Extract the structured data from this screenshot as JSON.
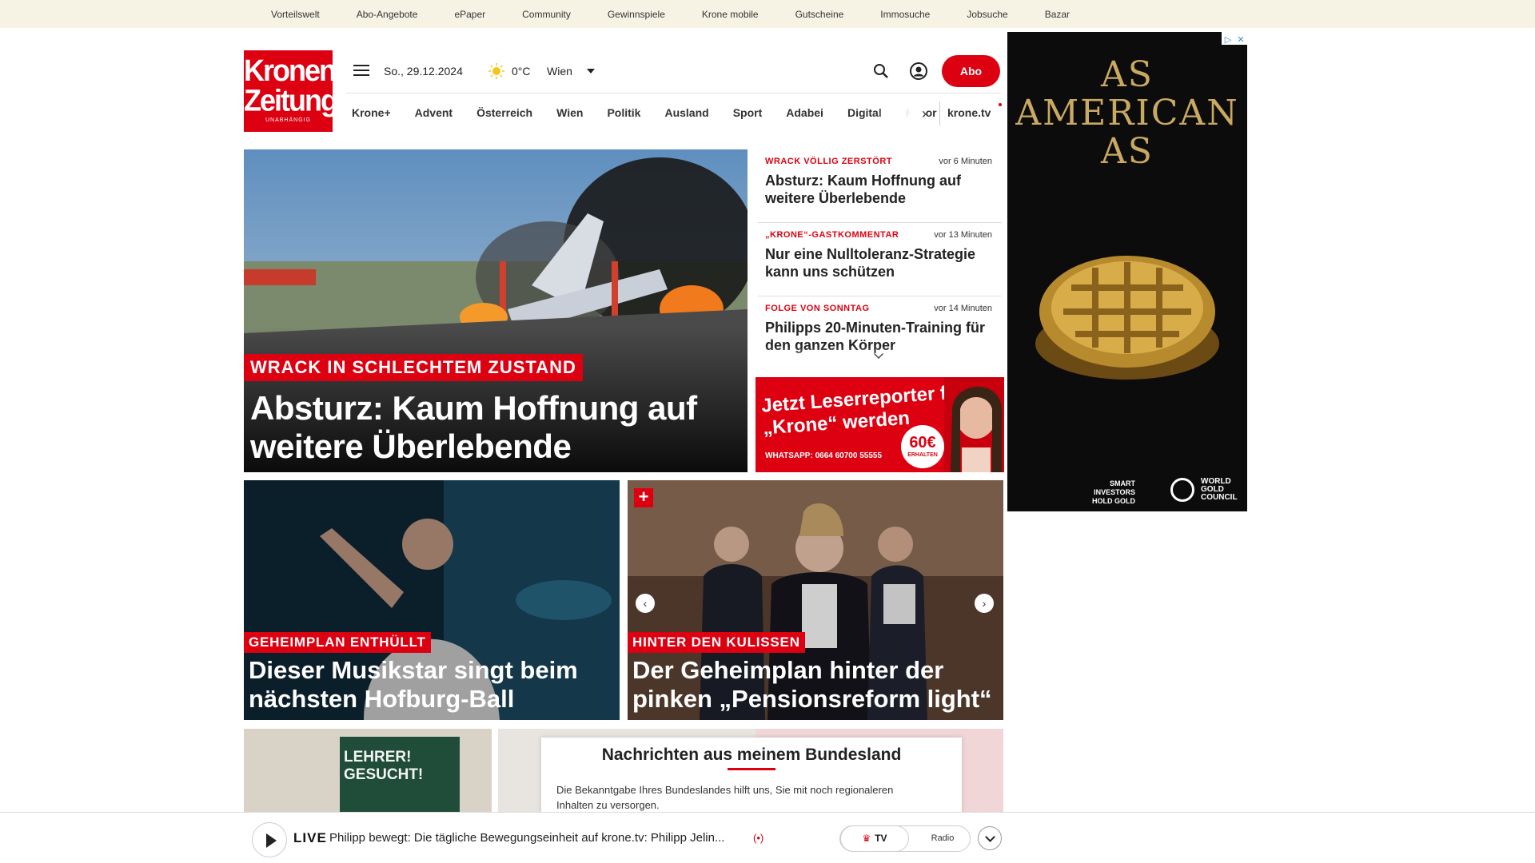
{
  "topbar": {
    "links": [
      "Vorteilswelt",
      "Abo-Angebote",
      "ePaper",
      "Community",
      "Gewinnspiele",
      "Krone mobile",
      "Gutscheine",
      "Immosuche",
      "Jobsuche",
      "Bazar"
    ]
  },
  "logo": {
    "line1": "Kronen",
    "line2": "Zeitung",
    "tagline": "UNABHÄNGIG"
  },
  "header": {
    "date": "So., 29.12.2024",
    "temperature": "0°C",
    "city": "Wien",
    "abo_label": "Abo"
  },
  "nav": {
    "items": [
      "Krone+",
      "Advent",
      "Österreich",
      "Wien",
      "Politik",
      "Ausland",
      "Sport",
      "Adabei",
      "Digital",
      "Motor"
    ],
    "kronetv": "krone.tv"
  },
  "hero": {
    "kicker": "WRACK IN SCHLECHTEM ZUSTAND",
    "title": "Absturz: Kaum Hoffnung auf weitere Überlebende"
  },
  "sidebar_news": [
    {
      "kicker": "WRACK VÖLLIG ZERSTÖRT",
      "time": "vor 6 Minuten",
      "headline": "Absturz: Kaum Hoffnung auf weitere Überlebende"
    },
    {
      "kicker": "„KRONE“-GASTKOMMENTAR",
      "time": "vor 13 Minuten",
      "headline": "Nur eine Nulltoleranz-Strategie kann uns schützen"
    },
    {
      "kicker": "FOLGE VON SONNTAG",
      "time": "vor 14 Minuten",
      "headline": "Philipps 20-Minuten-Training für den ganzen Körper"
    }
  ],
  "reporter_promo": {
    "headline": "Jetzt Leserreporter für die „Krone“ werden",
    "whatsapp": "WHATSAPP: 0664 60700 55555",
    "amount": "60€",
    "amount_note": "ERHALTEN"
  },
  "ad": {
    "headline": "AS AMERICAN AS",
    "slogan": "SMART INVESTORS HOLD GOLD",
    "brand": "WORLD GOLD COUNCIL"
  },
  "cards": [
    {
      "kicker": "GEHEIMPLAN ENTHÜLLT",
      "title": "Dieser Musikstar singt beim nächsten Hofburg-Ball"
    },
    {
      "kicker": "HINTER DEN KULISSEN",
      "title": "Der Geheimplan hinter der pinken „Pensionsreform light“",
      "plus": "+"
    }
  ],
  "classroom_sign": "LEHRER! GESUCHT!",
  "region_popup": {
    "title": "Nachrichten aus meinem Bundesland",
    "body": "Die Bekanntgabe Ihres Bundeslandes hilft uns, Sie mit noch regionaleren Inhalten zu versorgen."
  },
  "player": {
    "live_label": "LIVE",
    "title": "Philipp bewegt: Die tägliche Bewegungseinheit auf krone.tv: Philipp Jelin...",
    "tv_label": "TV",
    "radio_label": "Radio"
  },
  "colors": {
    "brand_red": "#dd0011",
    "topbar_bg": "#f7f3e4",
    "ad_gold": "#c9a961"
  }
}
